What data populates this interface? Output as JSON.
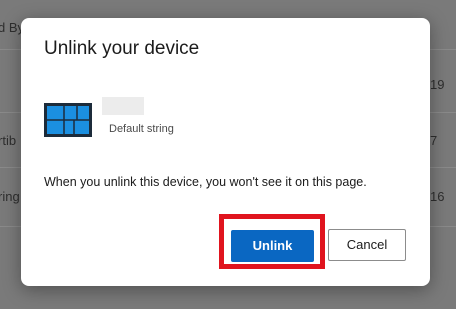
{
  "background": {
    "left_items": [
      "d By",
      "rtib",
      "ring"
    ],
    "right_items": [
      "19",
      "7",
      "16"
    ]
  },
  "dialog": {
    "title": "Unlink your device",
    "device": {
      "icon": "device-tile-icon",
      "subtitle": "Default string"
    },
    "message": "When you unlink this device, you won't see it on this page.",
    "primary_button": "Unlink",
    "secondary_button": "Cancel"
  },
  "colors": {
    "accent": "#0a67c2",
    "highlight": "#e0141e"
  }
}
